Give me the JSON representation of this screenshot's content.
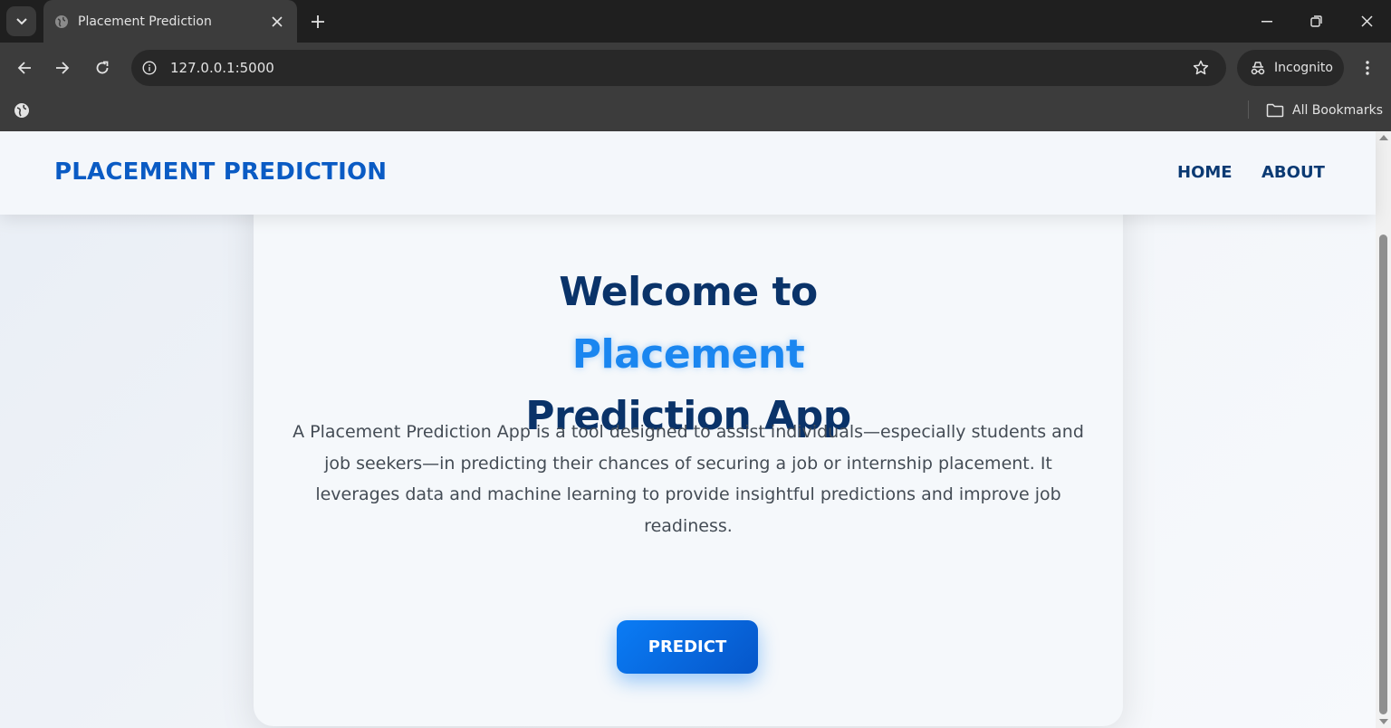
{
  "browser": {
    "tab_title": "Placement Prediction",
    "url": "127.0.0.1:5000",
    "incognito_label": "Incognito",
    "bookmarks_label": "All Bookmarks",
    "icons": [
      "tab-list-icon",
      "globe-icon",
      "close-icon",
      "plus-icon",
      "minimize-icon",
      "restore-icon",
      "window-close-icon",
      "back-icon",
      "forward-icon",
      "reload-icon",
      "info-icon",
      "star-icon",
      "incognito-icon",
      "more-vert-icon",
      "folder-icon"
    ]
  },
  "page": {
    "brand": "PLACEMENT PREDICTION",
    "nav": {
      "home": "HOME",
      "about": "ABOUT"
    },
    "hero": {
      "line1": "Welcome to",
      "line2": "Placement",
      "line3": "Prediction App",
      "description": "A Placement Prediction App is a tool designed to assist individuals—especially students and job seekers—in predicting their chances of securing a job or internship placement. It leverages data and machine learning to provide insightful predictions and improve job readiness.",
      "button": "PREDICT"
    }
  },
  "colors": {
    "brand": "#0a5bc4",
    "heading": "#0a3369",
    "accent": "#1a86f0",
    "button": "#0a7cf5"
  }
}
